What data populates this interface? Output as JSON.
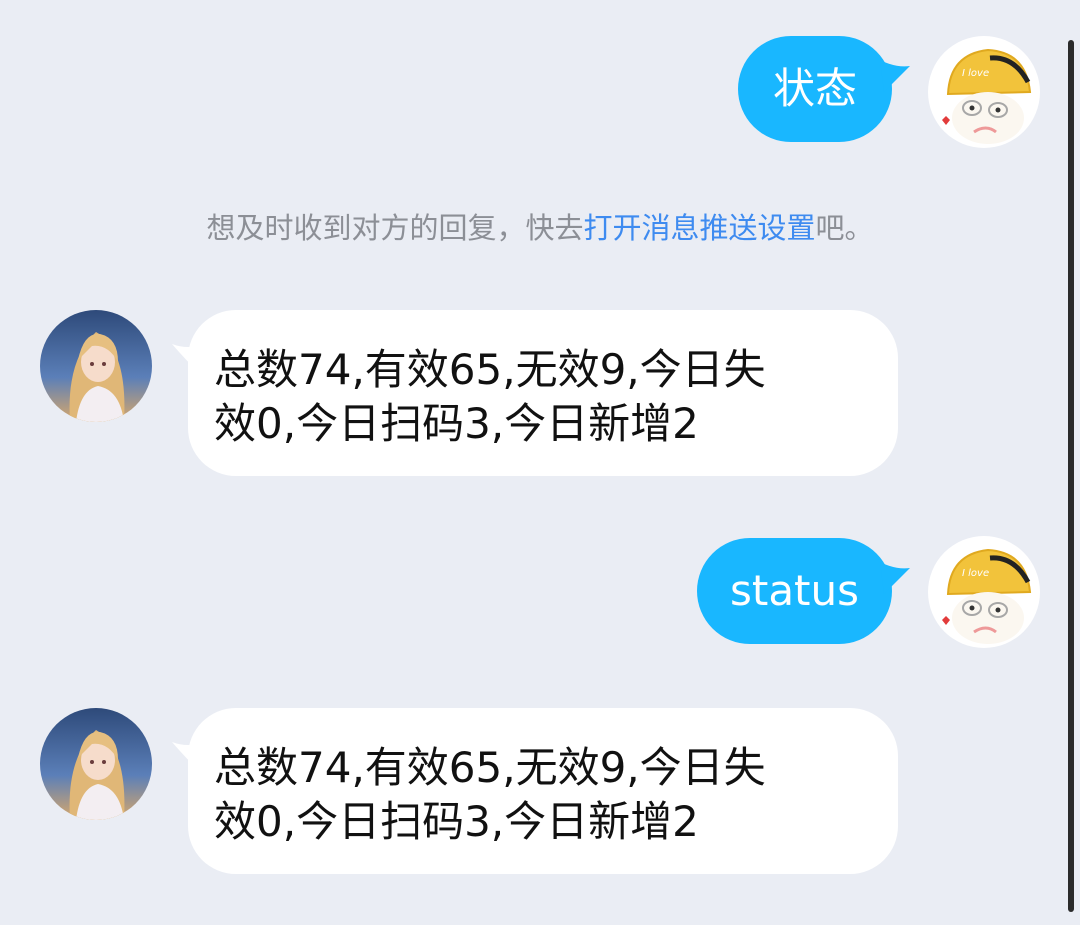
{
  "messages": [
    {
      "direction": "outgoing",
      "text": "状态",
      "sender_avatar": "cartoon-cap-avatar"
    },
    {
      "direction": "incoming",
      "line1": "总数74,有效65,无效9,今日失",
      "line2": "效0,今日扫码3,今日新增2",
      "sender_avatar": "anime-girl-avatar"
    },
    {
      "direction": "outgoing",
      "text": "status",
      "sender_avatar": "cartoon-cap-avatar"
    },
    {
      "direction": "incoming",
      "line1": "总数74,有效65,无效9,今日失",
      "line2": "效0,今日扫码3,今日新增2",
      "sender_avatar": "anime-girl-avatar"
    }
  ],
  "system_note": {
    "prefix": "想及时收到对方的回复，快去",
    "link": "打开消息推送设置",
    "suffix": "吧。"
  },
  "cap_text": "I love",
  "colors": {
    "background": "#eaedf4",
    "outgoing_bubble": "#19b7ff",
    "incoming_bubble": "#ffffff",
    "link": "#3e8bf0",
    "note_text": "#8c8f96"
  }
}
